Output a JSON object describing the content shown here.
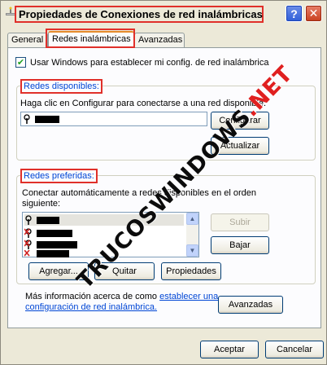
{
  "window": {
    "title": "Propiedades de Conexiones de red inalámbricas",
    "help_glyph": "?",
    "close_glyph": "✕"
  },
  "tabs": [
    {
      "label": "General"
    },
    {
      "label": "Redes inalámbricas",
      "selected": true
    },
    {
      "label": "Avanzadas"
    }
  ],
  "checkbox": {
    "checked": true,
    "label": "Usar Windows para establecer mi config. de red inalámbrica"
  },
  "available": {
    "group_label": "Redes disponibles:",
    "description": "Haga clic en Configurar para conectarse a una red disponible.",
    "items": [
      {
        "icon": "wireless-antenna-icon"
      }
    ],
    "buttons": {
      "configure": "Configurar",
      "refresh": "Actualizar"
    }
  },
  "preferred": {
    "group_label": "Redes preferidas:",
    "description_line1": "Conectar automáticamente a redes disponibles en el orden",
    "description_line2": "siguiente:",
    "items": [
      {
        "icon": "wireless-antenna-icon",
        "selected": true
      },
      {
        "icon": "wireless-disconnected-icon"
      },
      {
        "icon": "wireless-disconnected-icon"
      },
      {
        "icon": "wireless-disconnected-icon"
      }
    ],
    "buttons": {
      "up": "Subir",
      "down": "Bajar",
      "add": "Agregar...",
      "remove": "Quitar",
      "properties": "Propiedades"
    }
  },
  "info": {
    "text_before_link": "Más información acerca de como ",
    "link_part1": "establecer una",
    "link_part2": "configuración de red inalámbrica.",
    "advanced_button": "Avanzadas"
  },
  "footer": {
    "accept": "Aceptar",
    "cancel": "Cancelar"
  },
  "watermark": {
    "text": "TRUCOSWINDOWS",
    "suffix": ".NET"
  },
  "colors": {
    "highlight_box": "#E0302A",
    "group_label": "#0046D5",
    "dialog_bg": "#ECE9D8",
    "panel_bg": "#FCFCFE"
  }
}
